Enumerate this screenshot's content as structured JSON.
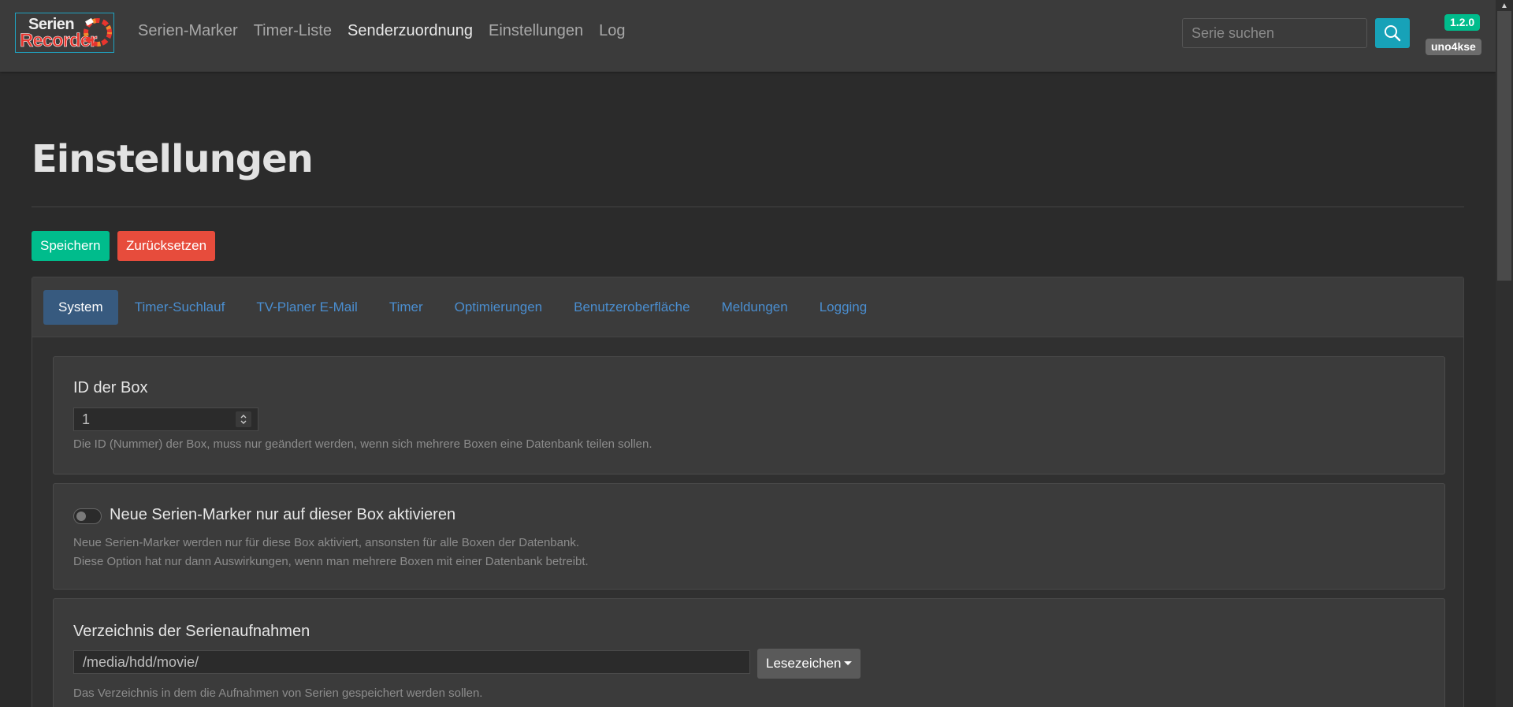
{
  "logo": {
    "line1": "Serien",
    "line2": "Recorder"
  },
  "nav": {
    "links": [
      "Serien-Marker",
      "Timer-Liste",
      "Senderzuordnung",
      "Einstellungen",
      "Log"
    ],
    "active_index": 2
  },
  "search": {
    "placeholder": "Serie suchen",
    "value": ""
  },
  "badges": {
    "version": "1.2.0",
    "user": "uno4kse"
  },
  "page": {
    "title": "Einstellungen"
  },
  "actions": {
    "save_label": "Speichern",
    "reset_label": "Zurücksetzen"
  },
  "tabs": {
    "items": [
      "System",
      "Timer-Suchlauf",
      "TV-Planer E-Mail",
      "Timer",
      "Optimierungen",
      "Benutzeroberfläche",
      "Meldungen",
      "Logging"
    ],
    "active_index": 0
  },
  "settings": {
    "box_id": {
      "label": "ID der Box",
      "value": "1",
      "help": "Die ID (Nummer) der Box, muss nur geändert werden, wenn sich mehrere Boxen eine Datenbank teilen sollen."
    },
    "marker_toggle": {
      "label": "Neue Serien-Marker nur auf dieser Box aktivieren",
      "checked": false,
      "help_line1": "Neue Serien-Marker werden nur für diese Box aktiviert, ansonsten für alle Boxen der Datenbank.",
      "help_line2": "Diese Option hat nur dann Auswirkungen, wenn man mehrere Boxen mit einer Datenbank betreibt."
    },
    "recording_dir": {
      "label": "Verzeichnis der Serienaufnahmen",
      "value": "/media/hdd/movie/",
      "bookmark_label": "Lesezeichen",
      "help": "Das Verzeichnis in dem die Aufnahmen von Serien gespeichert werden sollen."
    }
  },
  "colors": {
    "navbar_bg": "#3b3b3b",
    "page_bg": "#2b2b2b",
    "success": "#00bc8c",
    "danger": "#e74c3c",
    "info": "#17a2b8",
    "primary": "#375a7f",
    "link": "#4a8ed0"
  }
}
